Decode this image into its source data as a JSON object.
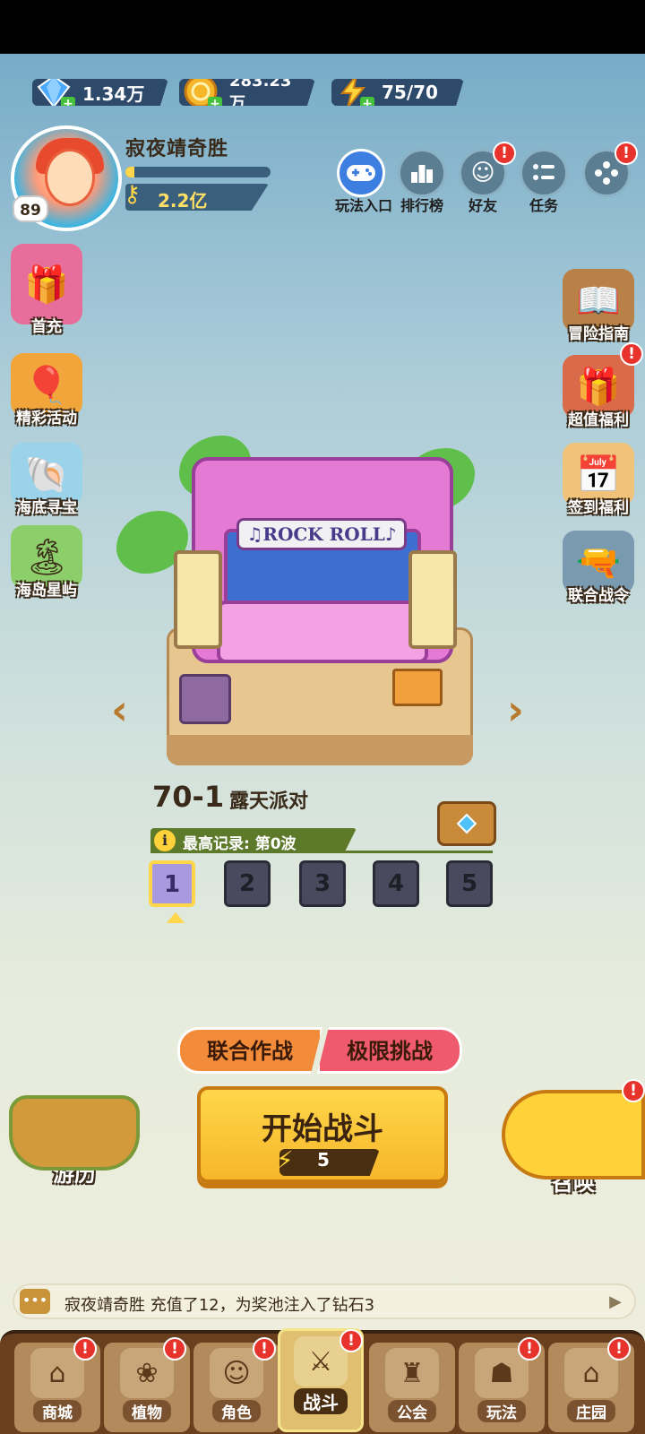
{
  "resources": {
    "diamond": {
      "value": "1.34万",
      "icon": "diamond-icon"
    },
    "gold": {
      "value": "283.23万",
      "icon": "gold-coin-icon"
    },
    "energy": {
      "value": "75/70",
      "icon": "lightning-icon"
    }
  },
  "player": {
    "name": "寂夜靖奇胜",
    "level": "89",
    "power": "2.2亿",
    "xp_fraction": 0.06
  },
  "top_menu": [
    {
      "label": "玩法入口",
      "icon": "gamepad-icon",
      "badge": ""
    },
    {
      "label": "排行榜",
      "icon": "leaderboard-icon",
      "badge": ""
    },
    {
      "label": "好友",
      "icon": "friends-icon",
      "badge": "!"
    },
    {
      "label": "任务",
      "icon": "tasks-icon",
      "badge": ""
    },
    {
      "label": "",
      "icon": "more-icon",
      "badge": "!"
    }
  ],
  "left_menu": [
    {
      "label": "首充",
      "icon": "first-recharge-icon"
    },
    {
      "label": "精彩活动",
      "icon": "events-icon"
    },
    {
      "label": "海底寻宝",
      "icon": "treasure-hunt-icon"
    },
    {
      "label": "海岛星屿",
      "icon": "island-icon"
    }
  ],
  "right_menu": [
    {
      "label": "冒险指南",
      "icon": "guide-book-icon",
      "badge": ""
    },
    {
      "label": "超值福利",
      "icon": "value-gift-icon",
      "badge": "!"
    },
    {
      "label": "签到福利",
      "icon": "checkin-calendar-icon",
      "badge": ""
    },
    {
      "label": "联合战令",
      "icon": "battle-pass-icon",
      "badge": ""
    }
  ],
  "stage": {
    "sign_text": "♫ROCK ROLL♪",
    "level_code": "70-1",
    "level_name": "露天派对",
    "record_label": "最高记录: 第0波",
    "waves": [
      "1",
      "2",
      "3",
      "4",
      "5"
    ],
    "active_wave": "1"
  },
  "modes": {
    "coop": "联合作战",
    "limit": "极限挑战"
  },
  "start": {
    "label": "开始战斗",
    "cost": "5"
  },
  "travel_label": "游历",
  "summon_label": "召唤",
  "ticker": {
    "text": "寂夜靖奇胜 充值了12，为奖池注入了钻石3"
  },
  "nav": [
    {
      "label": "商城",
      "icon": "shop-icon",
      "badge": "!"
    },
    {
      "label": "植物",
      "icon": "plants-icon",
      "badge": "!"
    },
    {
      "label": "角色",
      "icon": "characters-icon",
      "badge": "!"
    },
    {
      "label": "战斗",
      "icon": "battle-icon",
      "badge": "!"
    },
    {
      "label": "公会",
      "icon": "guild-icon",
      "badge": ""
    },
    {
      "label": "玩法",
      "icon": "modes-icon",
      "badge": "!"
    },
    {
      "label": "庄园",
      "icon": "manor-icon",
      "badge": "!"
    }
  ],
  "colors": {
    "accent_yellow": "#ffd54a",
    "badge_red": "#e8322c",
    "coop_orange": "#f28c3a",
    "limit_red": "#ef5a6e"
  }
}
